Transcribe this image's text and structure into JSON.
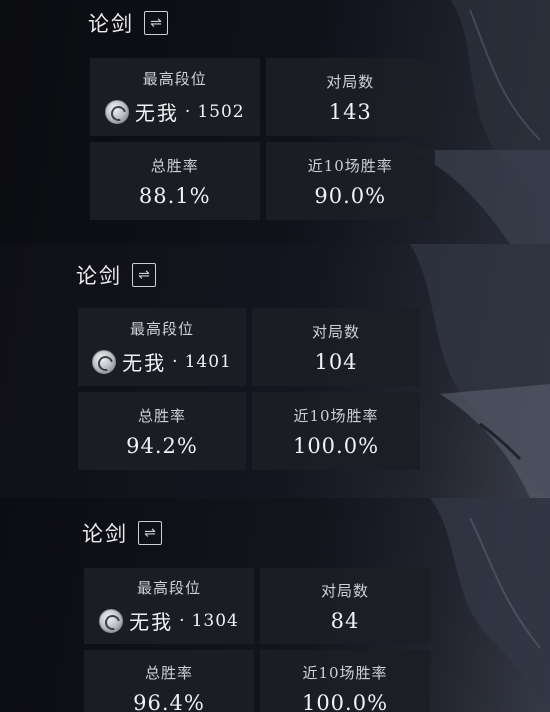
{
  "sections": [
    {
      "title": "论剑",
      "switch_icon": "swap-arrows-icon",
      "best_rank_label": "最高段位",
      "rank_name": "无我",
      "rank_separator": "·",
      "rank_score": "1502",
      "matches_label": "对局数",
      "matches_value": "143",
      "winrate_label": "总胜率",
      "winrate_value": "88.1%",
      "recent_label": "近10场胜率",
      "recent_value": "90.0%"
    },
    {
      "title": "论剑",
      "switch_icon": "swap-arrows-icon",
      "best_rank_label": "最高段位",
      "rank_name": "无我",
      "rank_separator": "·",
      "rank_score": "1401",
      "matches_label": "对局数",
      "matches_value": "104",
      "winrate_label": "总胜率",
      "winrate_value": "94.2%",
      "recent_label": "近10场胜率",
      "recent_value": "100.0%"
    },
    {
      "title": "论剑",
      "switch_icon": "swap-arrows-icon",
      "best_rank_label": "最高段位",
      "rank_name": "无我",
      "rank_separator": "·",
      "rank_score": "1304",
      "matches_label": "对局数",
      "matches_value": "84",
      "winrate_label": "总胜率",
      "winrate_value": "96.4%",
      "recent_label": "近10场胜率",
      "recent_value": "100.0%"
    }
  ]
}
